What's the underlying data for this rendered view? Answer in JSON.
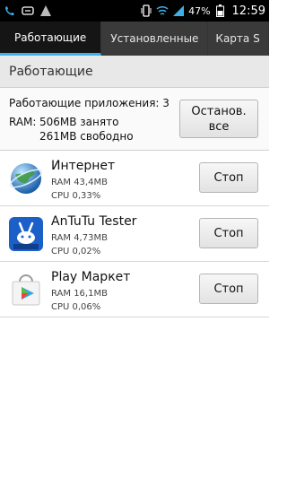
{
  "status": {
    "battery": "47%",
    "time": "12:59",
    "icons": [
      "missed-call-icon",
      "message-icon",
      "warning-icon",
      "vibrate-icon",
      "wifi-icon",
      "signal-icon",
      "battery-icon"
    ]
  },
  "tabs": [
    {
      "label": "Работающие",
      "active": true
    },
    {
      "label": "Установленные",
      "active": false
    },
    {
      "label": "Карта S",
      "active": false
    }
  ],
  "section": {
    "title": "Работающие"
  },
  "summary": {
    "running_apps": "Работающие приложения: 3",
    "ram_label": "RAM:",
    "ram_used": "506MB занято",
    "ram_free": "261MB свободно",
    "stop_all_label": "Останов.\nвсе"
  },
  "apps": [
    {
      "name": "Интернет",
      "ram": "RAM 43,4MB",
      "cpu": "CPU 0,33%",
      "icon": "globe-icon",
      "stop_label": "Стоп"
    },
    {
      "name": "AnTuTu Tester",
      "ram": "RAM 4,73MB",
      "cpu": "CPU 0,02%",
      "icon": "antutu-icon",
      "stop_label": "Стоп"
    },
    {
      "name": "Play Маркет",
      "ram": "RAM 16,1MB",
      "cpu": "CPU 0,06%",
      "icon": "play-store-icon",
      "stop_label": "Стоп"
    }
  ]
}
